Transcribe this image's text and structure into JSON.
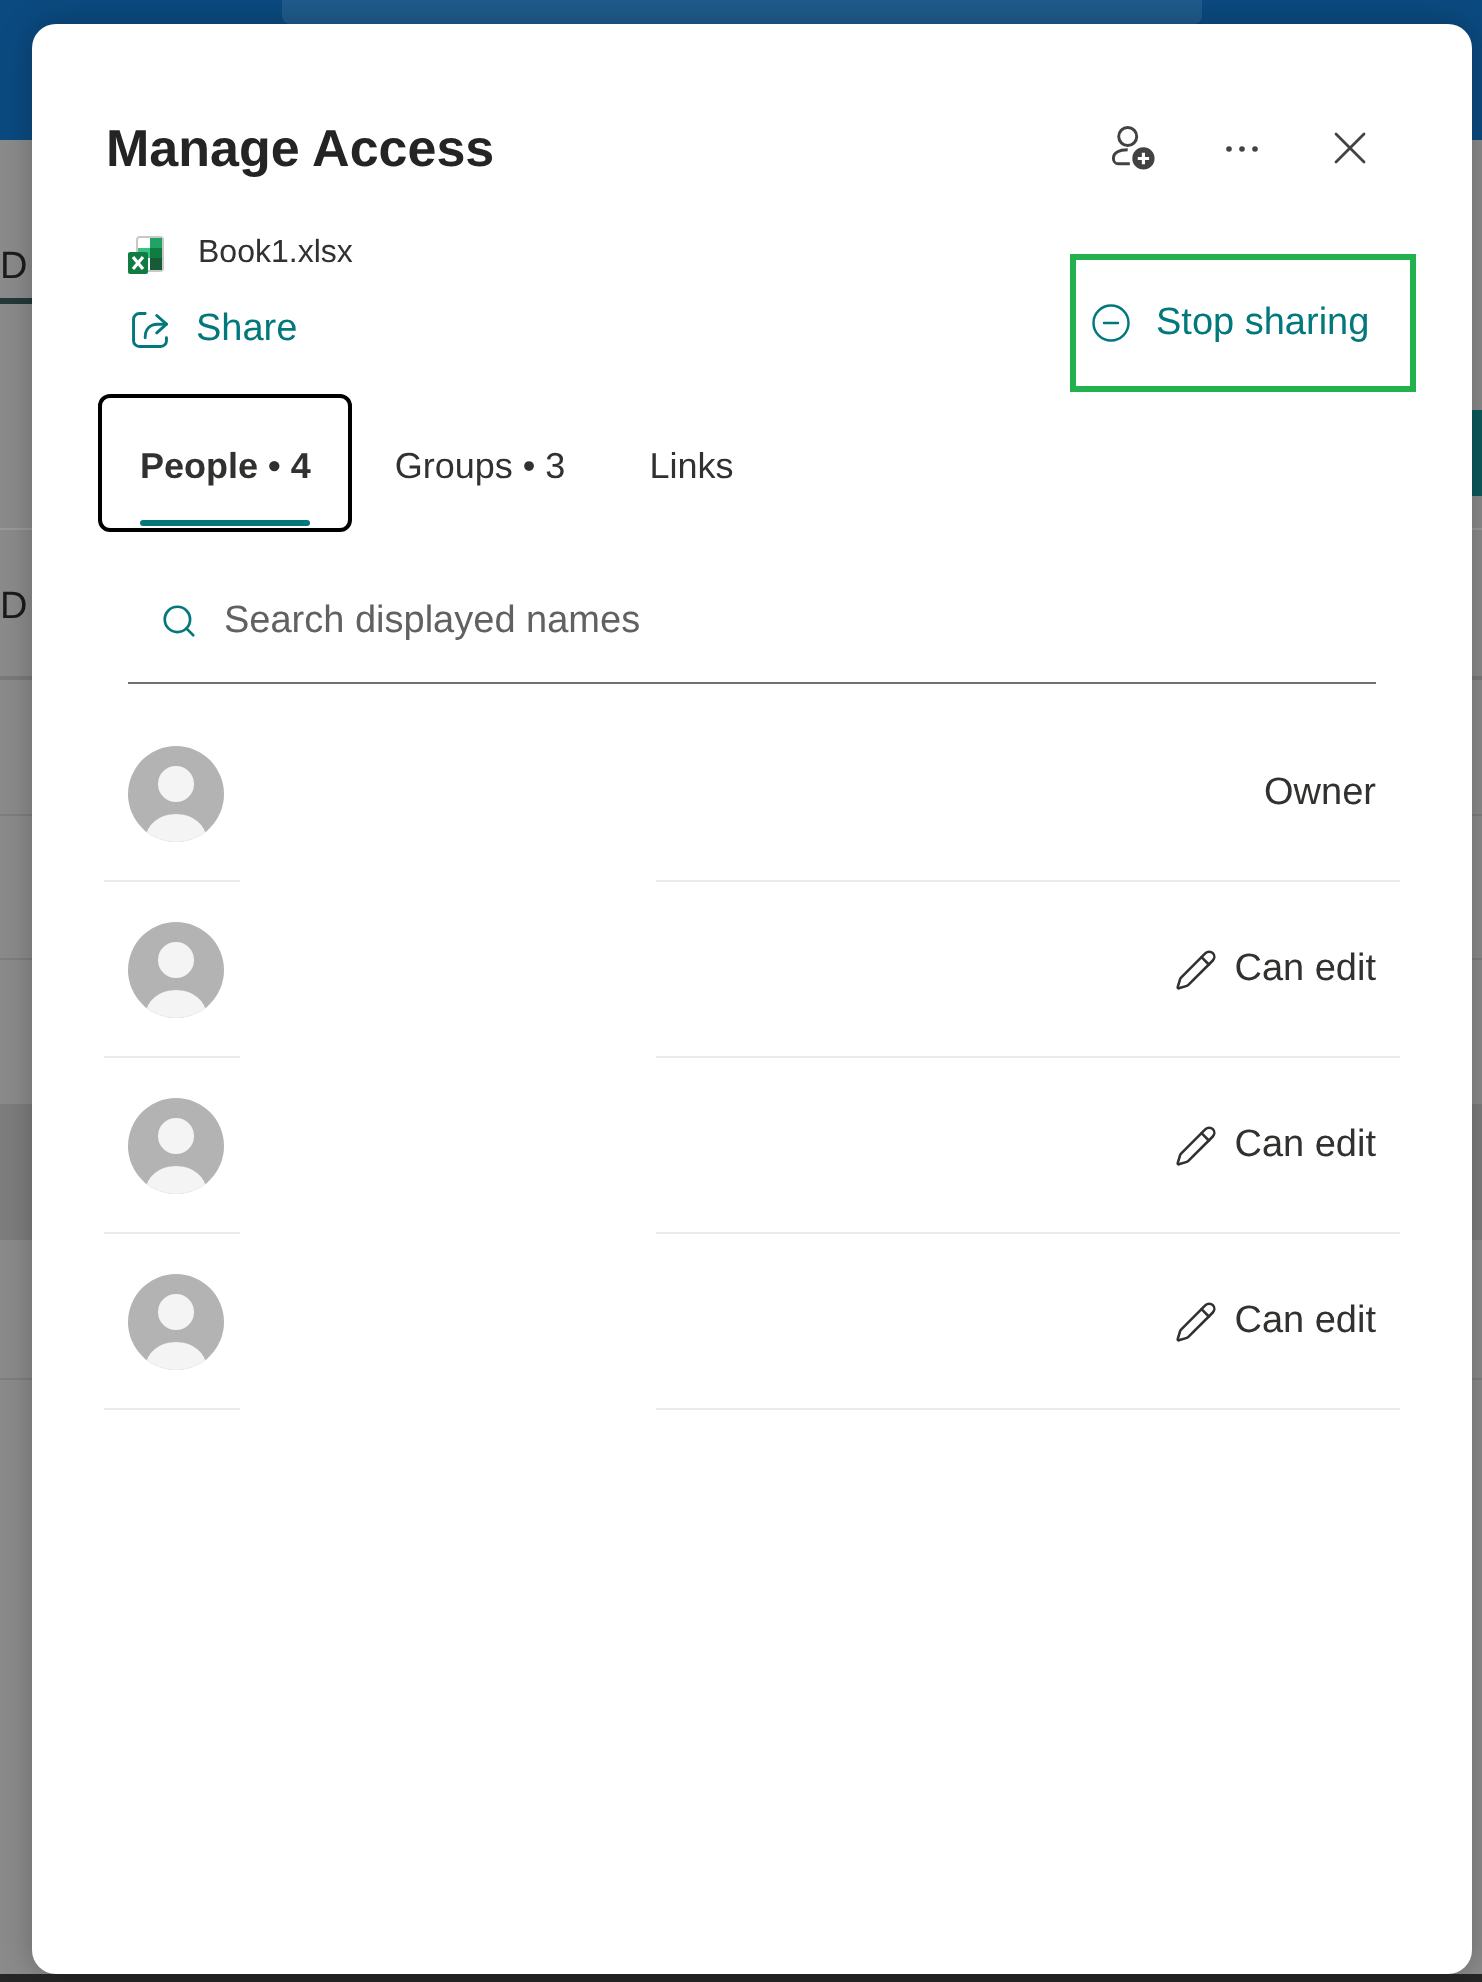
{
  "background": {
    "labels": [
      "D",
      "D"
    ]
  },
  "dialog": {
    "title": "Manage Access",
    "file": {
      "name": "Book1.xlsx"
    },
    "share": {
      "label": "Share"
    },
    "stop_sharing": {
      "label": "Stop sharing",
      "highlighted": true
    },
    "tabs": [
      {
        "label": "People • 4",
        "selected": true,
        "focused": true
      },
      {
        "label": "Groups • 3",
        "selected": false,
        "focused": false
      },
      {
        "label": "Links",
        "selected": false,
        "focused": false
      }
    ],
    "search": {
      "placeholder": "Search displayed names"
    },
    "people": [
      {
        "role": "Owner",
        "kind": "owner"
      },
      {
        "role": "Can edit",
        "kind": "editor"
      },
      {
        "role": "Can edit",
        "kind": "editor"
      },
      {
        "role": "Can edit",
        "kind": "editor"
      }
    ]
  }
}
